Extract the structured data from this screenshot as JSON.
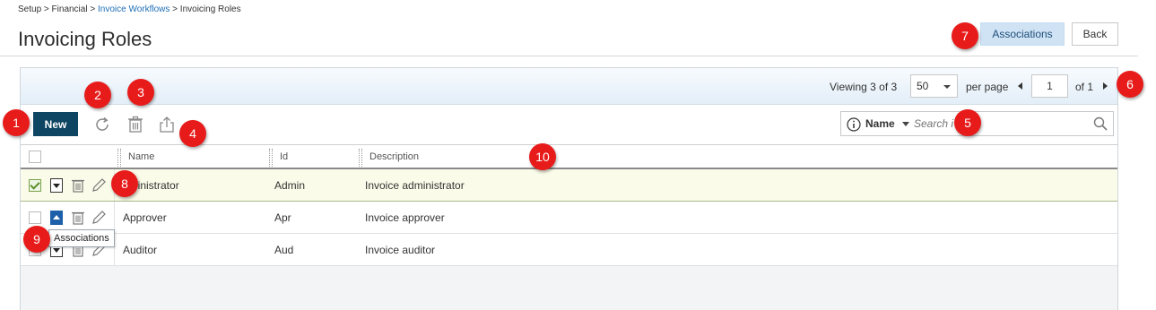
{
  "breadcrumb": {
    "setup": "Setup",
    "sep1": ">",
    "financial": "Financial",
    "sep2": ">",
    "workflows": "Invoice Workflows",
    "sep3": ">",
    "current": "Invoicing Roles"
  },
  "page": {
    "title": "Invoicing Roles"
  },
  "header_buttons": {
    "associations": "Associations",
    "back": "Back"
  },
  "pagination": {
    "viewing_label": "Viewing",
    "viewing_value": "3 of 3",
    "per_page_value": "50",
    "per_page_label": "per page",
    "page_value": "1",
    "of_label": "of 1"
  },
  "toolbar": {
    "new_label": "New"
  },
  "search": {
    "field_label": "Name",
    "placeholder": "Search i"
  },
  "table": {
    "columns": [
      "Name",
      "Id",
      "Description"
    ],
    "rows": [
      {
        "name": "Administrator",
        "name_visible": "dministrator",
        "id": "Admin",
        "description": "Invoice administrator",
        "checked": true,
        "expanded": false
      },
      {
        "name": "Approver",
        "name_visible": "Approver",
        "id": "Apr",
        "description": "Invoice approver",
        "checked": false,
        "expanded": true
      },
      {
        "name": "Auditor",
        "name_visible": "Auditor",
        "id": "Aud",
        "description": "Invoice auditor",
        "checked": false,
        "expanded": false
      }
    ]
  },
  "tooltip": {
    "text": "Associations"
  },
  "markers": [
    "1",
    "2",
    "3",
    "4",
    "5",
    "6",
    "7",
    "8",
    "9",
    "10"
  ],
  "colors": {
    "primary_button": "#0d4562",
    "associations_button": "#cfe3f5",
    "link": "#1f6fb5",
    "selected_row": "#fbfbe9",
    "marker": "#e81b1b"
  }
}
